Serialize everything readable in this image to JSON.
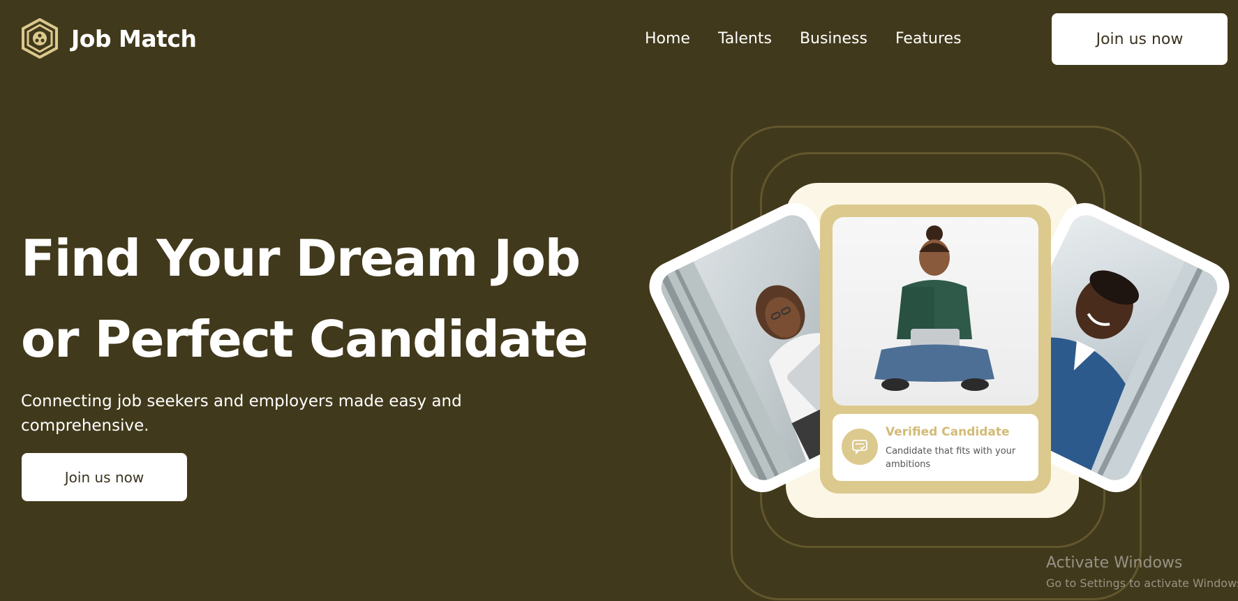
{
  "brand": {
    "name": "Job Match",
    "logo_icon": "hexagon-people-logo-icon",
    "accent_color": "#dcc98e",
    "background_color": "#41391b"
  },
  "nav": {
    "items": [
      {
        "label": "Home"
      },
      {
        "label": "Talents"
      },
      {
        "label": "Business"
      },
      {
        "label": "Features"
      }
    ],
    "cta_label": "Join us now"
  },
  "hero": {
    "title_line1": "Find Your Dream Job",
    "title_line2": "or Perfect Candidate",
    "subtitle": "Connecting job seekers and employers made easy and comprehensive.",
    "cta_label": "Join us now"
  },
  "candidate_card": {
    "title": "Verified Candidate",
    "description": "Candidate that fits with your ambitions",
    "icon": "chat-check-icon"
  },
  "watermark": {
    "title": "Activate Windows",
    "subtitle": "Go to Settings to activate Windows."
  }
}
